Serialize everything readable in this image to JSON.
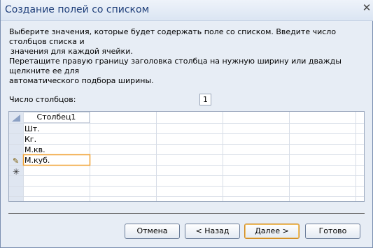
{
  "window": {
    "title": "Создание полей со списком"
  },
  "instructions": {
    "line1": "Выберите значения, которые будет содержать поле со списком. Введите число столбцов списка и",
    "line2": "значения для каждой ячейки.",
    "line3": "Перетащите правую границу заголовка столбца на нужную ширину или дважды щелкните ее для",
    "line4": "автоматического подбора ширины."
  },
  "columns_count": {
    "label": "Число столбцов:",
    "value": "1"
  },
  "grid": {
    "header": "Столбец1",
    "rows": [
      "Шт.",
      "Кг.",
      "М.кв.",
      "М.куб."
    ]
  },
  "buttons": {
    "cancel": "Отмена",
    "back": "< Назад",
    "next": "Далее >",
    "finish": "Готово"
  }
}
